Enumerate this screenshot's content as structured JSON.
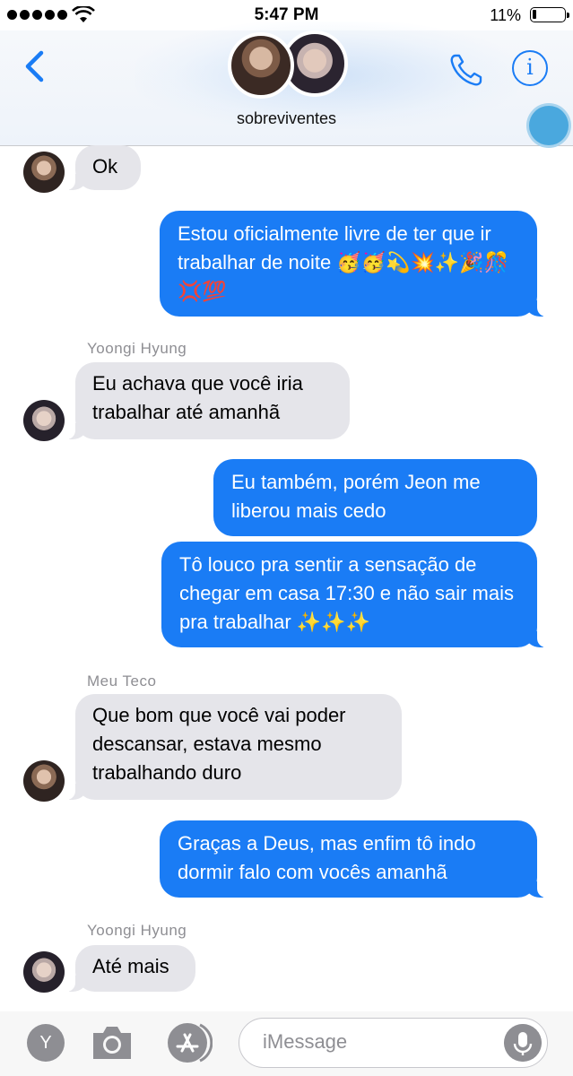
{
  "status_bar": {
    "time": "5:47 PM",
    "battery_percent": "11%"
  },
  "header": {
    "group_name": "sobreviventes"
  },
  "messages": [
    {
      "text": "Ok"
    },
    {
      "text": "Estou oficialmente livre de ter que ir trabalhar de noite 🥳🥳💫💥✨🎉🎊💢💯"
    },
    {
      "sender": "Yoongi Hyung",
      "text": "Eu achava que você iria trabalhar até amanhã"
    },
    {
      "text": "Eu também, porém Jeon me liberou mais cedo"
    },
    {
      "text": "Tô louco pra sentir a sensação de chegar em casa 17:30 e não sair mais pra trabalhar ✨✨✨"
    },
    {
      "sender": "Meu Teco",
      "text": "Que bom que você vai poder descansar, estava mesmo trabalhando duro"
    },
    {
      "text": "Graças a Deus, mas enfim tô indo dormir falo com vocês amanhã"
    },
    {
      "sender": "Yoongi Hyung",
      "text": "Até mais"
    }
  ],
  "composer": {
    "y_button": "Y",
    "placeholder": "iMessage"
  },
  "colors": {
    "accent": "#1a7cf5",
    "incoming_bubble": "#e5e5ea"
  },
  "icons": [
    "back-chevron-icon",
    "phone-icon",
    "info-icon",
    "camera-icon",
    "app-store-icon",
    "microphone-icon"
  ]
}
